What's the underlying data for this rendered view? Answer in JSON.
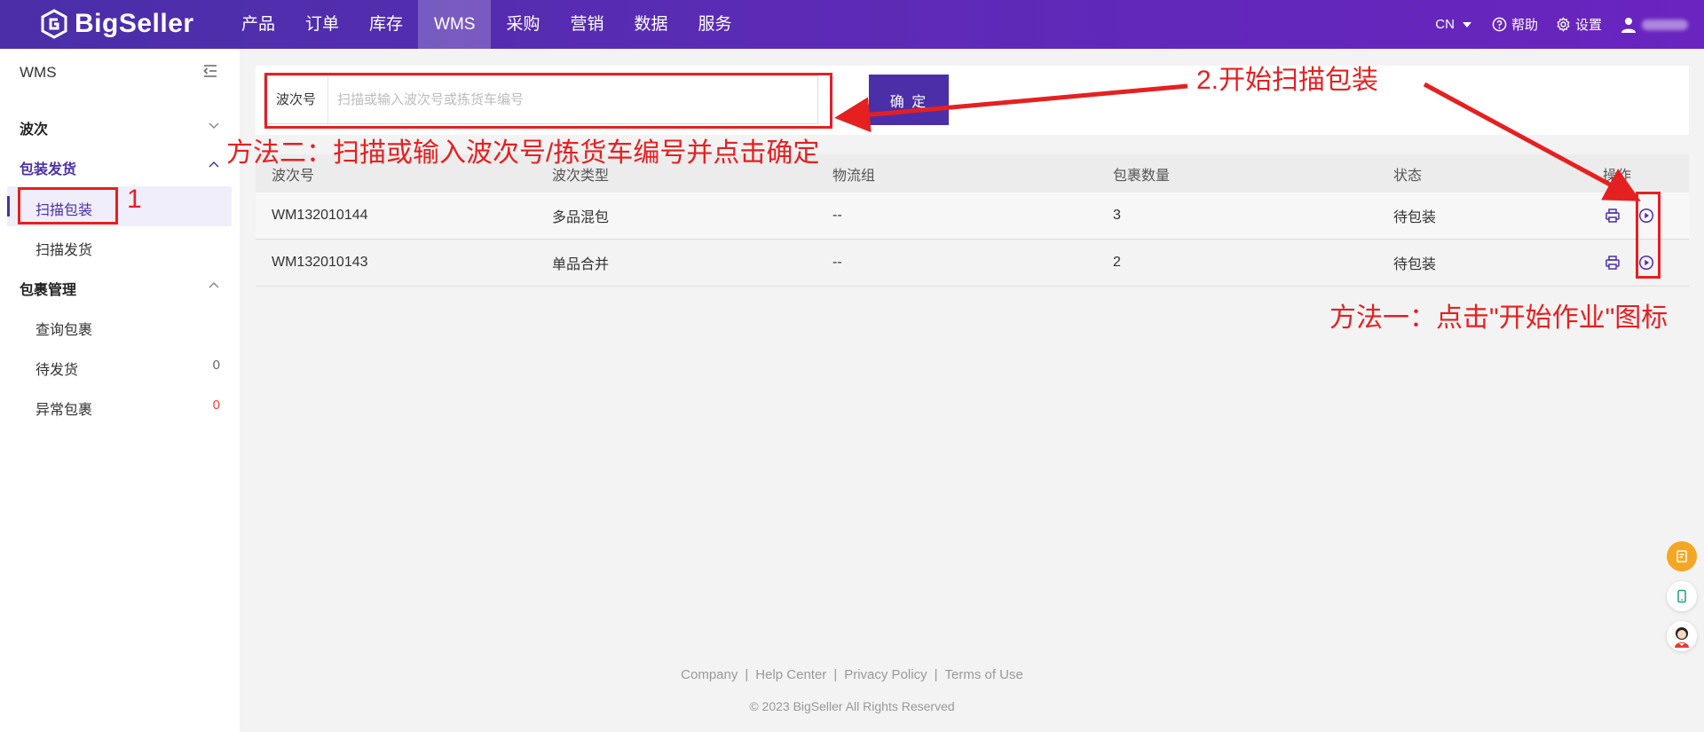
{
  "header": {
    "logo_text": "BigSeller",
    "nav": [
      "产品",
      "订单",
      "库存",
      "WMS",
      "采购",
      "营销",
      "数据",
      "服务"
    ],
    "active_nav_index": 3,
    "lang": "CN",
    "help_label": "帮助",
    "settings_label": "设置"
  },
  "sidebar": {
    "title": "WMS",
    "groups": [
      {
        "label": "波次"
      },
      {
        "label": "包装发货",
        "items": [
          {
            "label": "扫描包装"
          },
          {
            "label": "扫描发货"
          }
        ]
      },
      {
        "label": "包裹管理",
        "items": [
          {
            "label": "查询包裹"
          },
          {
            "label": "待发货",
            "count": "0"
          },
          {
            "label": "异常包裹",
            "count": "0"
          }
        ]
      }
    ]
  },
  "search": {
    "label": "波次号",
    "placeholder": "扫描或输入波次号或拣货车编号",
    "value": "",
    "confirm_label": "确 定"
  },
  "table": {
    "columns": [
      "波次号",
      "波次类型",
      "物流组",
      "包裹数量",
      "状态",
      "操作"
    ],
    "rows": [
      {
        "wave_no": "WM132010144",
        "type": "多品混包",
        "logistics": "--",
        "count": "3",
        "status": "待包装"
      },
      {
        "wave_no": "WM132010143",
        "type": "单品合并",
        "logistics": "--",
        "count": "2",
        "status": "待包装"
      }
    ]
  },
  "footer": {
    "links": [
      "Company",
      "Help Center",
      "Privacy Policy",
      "Terms of Use"
    ],
    "copyright": "© 2023 BigSeller All Rights Reserved"
  },
  "annotations": {
    "step1": "1",
    "step2": "2.开始扫描包装",
    "method2": "方法二：扫描或输入波次号/拣货车编号并点击确定",
    "method1": "方法一：点击\"开始作业\"图标"
  },
  "colors": {
    "brand": "#4b2fa8",
    "annotation": "#e52020"
  },
  "icons": {
    "print": "printer-icon",
    "start": "play-circle-icon"
  }
}
